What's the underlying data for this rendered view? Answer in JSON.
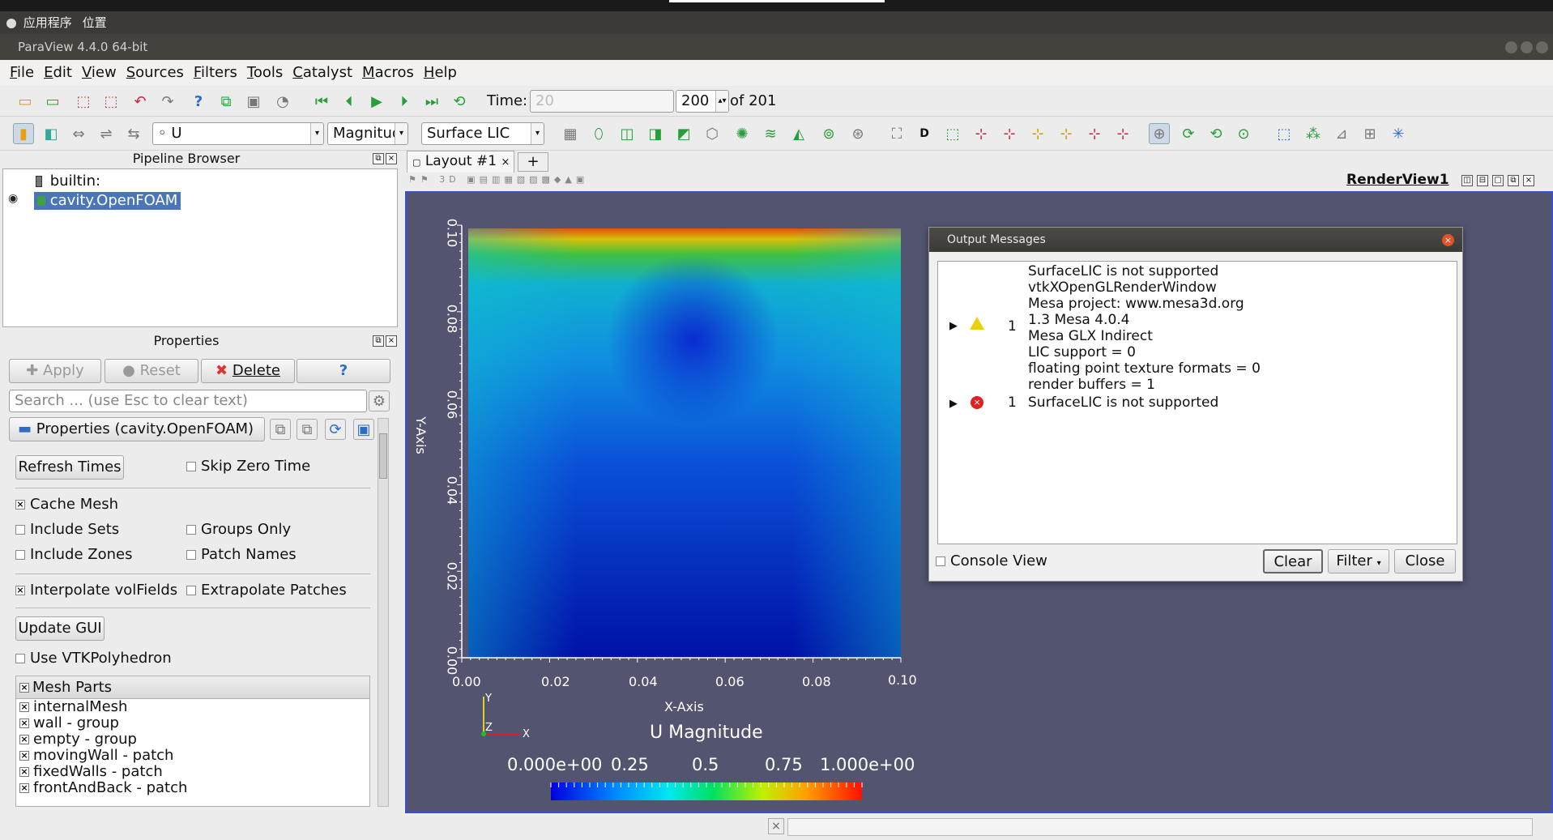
{
  "system": {
    "apps_label": "应用程序",
    "places_label": "位置"
  },
  "window": {
    "title": "ParaView 4.4.0 64-bit"
  },
  "menu": [
    "File",
    "Edit",
    "View",
    "Sources",
    "Filters",
    "Tools",
    "Catalyst",
    "Macros",
    "Help"
  ],
  "time": {
    "label": "Time:",
    "value": "20",
    "index": "200",
    "of_label": "of 201"
  },
  "toolbar2": {
    "variable": "U",
    "component": "Magnitud",
    "representation": "Surface LIC"
  },
  "pipeline": {
    "title": "Pipeline Browser",
    "builtin": "builtin:",
    "source": "cavity.OpenFOAM"
  },
  "properties": {
    "title": "Properties",
    "apply": "Apply",
    "reset": "Reset",
    "delete": "Delete",
    "help": "?",
    "search_placeholder": "Search ... (use Esc to clear text)",
    "section": "Properties (cavity.OpenFOAM)",
    "refresh_times": "Refresh Times",
    "skip_zero_time": "Skip Zero Time",
    "cache_mesh": "Cache Mesh",
    "include_sets": "Include Sets",
    "groups_only": "Groups Only",
    "include_zones": "Include Zones",
    "patch_names": "Patch Names",
    "interpolate": "Interpolate volFields",
    "extrapolate": "Extrapolate Patches",
    "update_gui": "Update GUI",
    "use_vtk": "Use VTKPolyhedron",
    "mesh_parts_header": "Mesh Parts",
    "mesh_parts": [
      "internalMesh",
      "wall - group",
      "empty - group",
      "movingWall - patch",
      "fixedWalls - patch",
      "frontAndBack - patch"
    ]
  },
  "layout": {
    "tab": "Layout #1",
    "view_name": "RenderView1"
  },
  "plot": {
    "xlabel": "X-Axis",
    "ylabel": "Y-Axis",
    "xticks": [
      "0.00",
      "0.02",
      "0.04",
      "0.06",
      "0.08",
      "0.10"
    ],
    "yticks": [
      "0.00",
      "0.02",
      "0.04",
      "0.06",
      "0.08",
      "0.10"
    ],
    "colorbar_title": "U Magnitude",
    "colorbar_labels": [
      "0.000e+00",
      "0.25",
      "0.5",
      "0.75",
      "1.000e+00"
    ]
  },
  "output": {
    "title": "Output Messages",
    "msg1_count": "1",
    "msg1_text": "SurfaceLIC is not supported\nvtkXOpenGLRenderWindow\nMesa project: www.mesa3d.org\n1.3 Mesa 4.0.4\nMesa GLX Indirect\nLIC support = 0\nfloating point texture formats = 0\nrender buffers = 1",
    "msg2_count": "1",
    "msg2_text": "SurfaceLIC is not supported",
    "console_view": "Console View",
    "clear": "Clear",
    "filter": "Filter",
    "close": "Close"
  },
  "colors": {
    "render_bg": "#525470",
    "selection": "#4a76b8",
    "border_blue": "#3a4fd0"
  }
}
